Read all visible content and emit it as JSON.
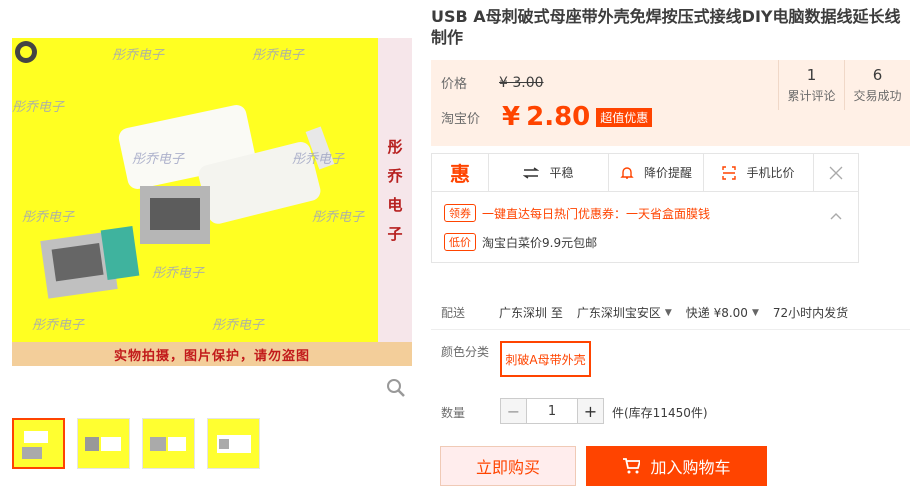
{
  "product": {
    "title": "USB A母刺破式母座带外壳免焊按压式接线DIY电脑数据线延长线制作"
  },
  "gallery": {
    "watermark": "彤乔电子",
    "banner": "实物拍摄，图片保护，请勿盗图",
    "side_chars": [
      "彤",
      "乔",
      "电",
      "子"
    ]
  },
  "price": {
    "original_label": "价格",
    "original": "¥ 3.00",
    "promo_label": "淘宝价",
    "promo_symbol": "¥",
    "promo": "2.80",
    "badge": "超值优惠"
  },
  "stats": [
    {
      "value": "1",
      "label": "累计评论"
    },
    {
      "value": "6",
      "label": "交易成功"
    }
  ],
  "promo_bar": {
    "hui": "惠",
    "trend": "平稳",
    "alert": "降价提醒",
    "compare": "手机比价"
  },
  "coupons": [
    {
      "tag": "领券",
      "text": "一键直达每日热门优惠券：一天省盒面膜钱",
      "color": "#ff4400"
    },
    {
      "tag": "低价",
      "text": "淘宝白菜价9.9元包邮",
      "color": "#3c3c3c"
    }
  ],
  "delivery": {
    "label": "配送",
    "from": "广东深圳 至",
    "to": "广东深圳宝安区",
    "fee": "快递 ¥8.00",
    "ship": "72小时内发货"
  },
  "color": {
    "label": "颜色分类",
    "option": "刺破A母带外壳"
  },
  "quantity": {
    "label": "数量",
    "value": "1",
    "stock": "件(库存11450件)"
  },
  "actions": {
    "buy_now": "立即购买",
    "add_cart": "加入购物车"
  },
  "colors": {
    "accent": "#ff4400"
  }
}
